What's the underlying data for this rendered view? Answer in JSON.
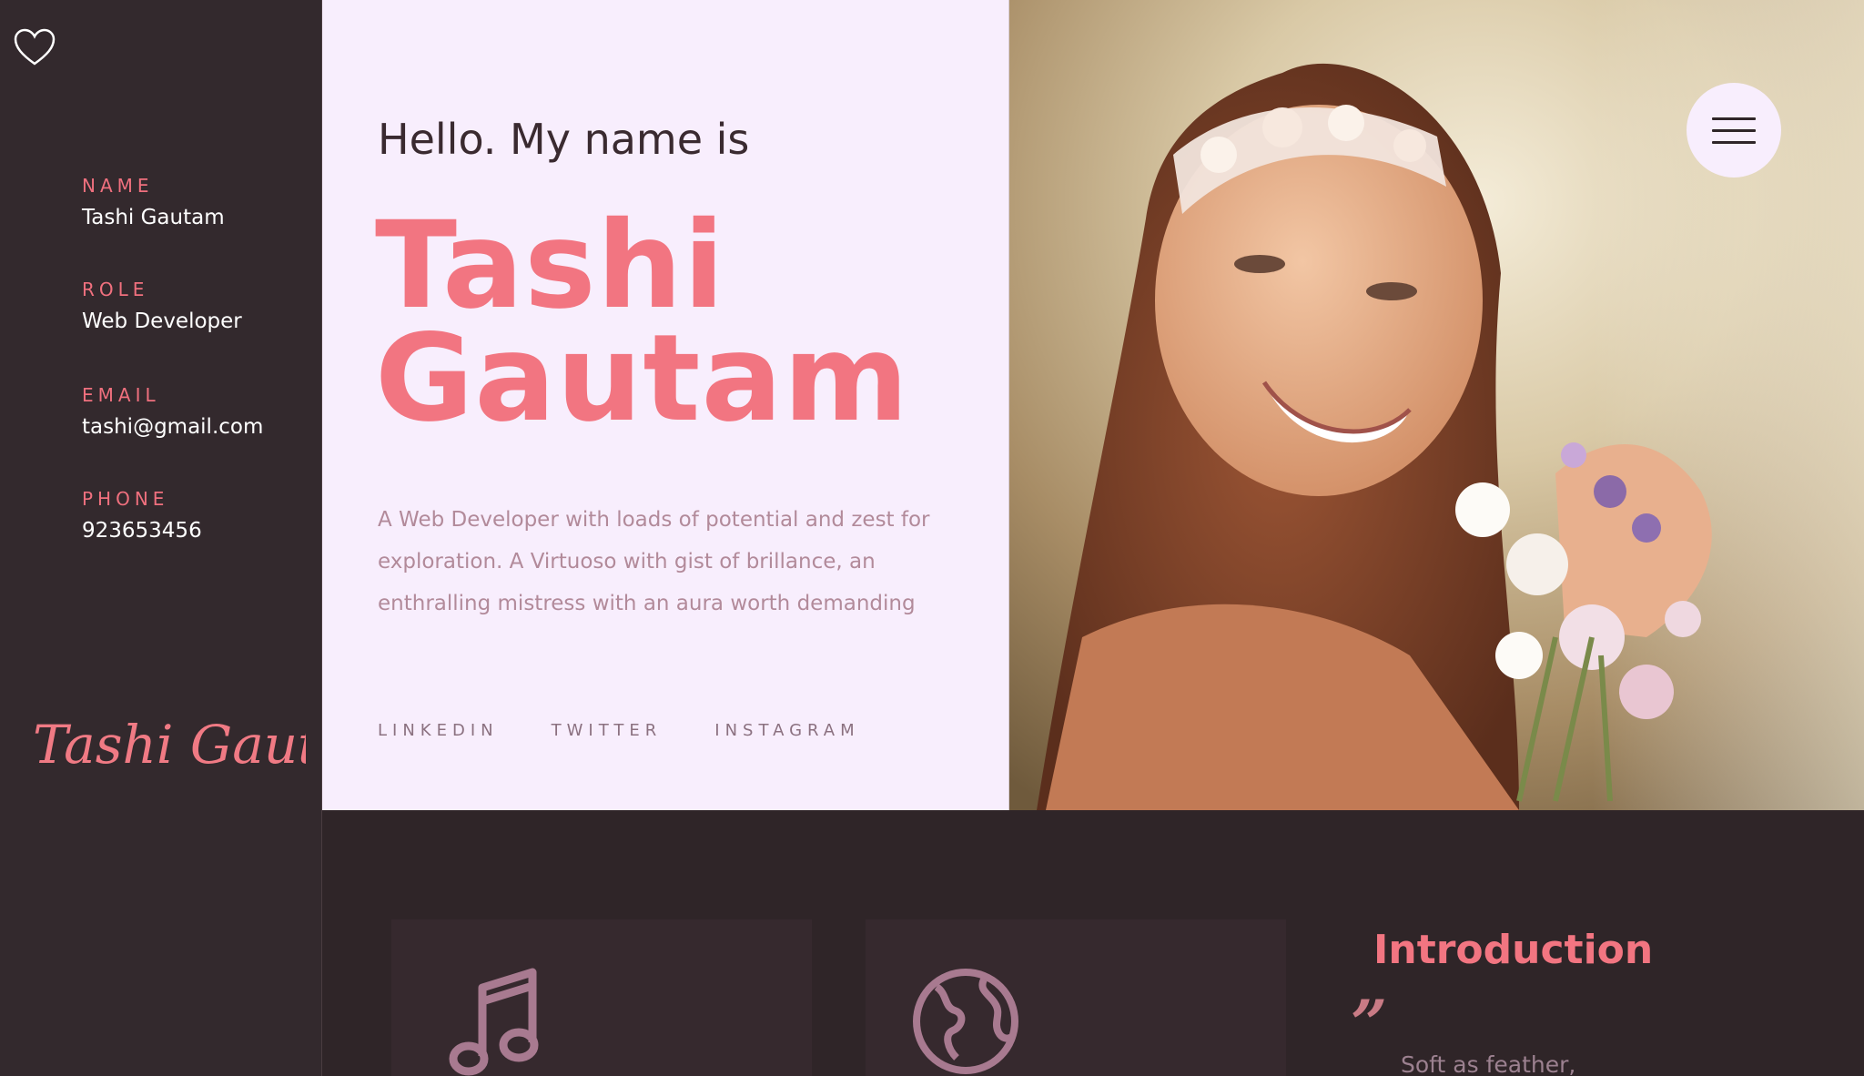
{
  "sidebar": {
    "heart_icon": "heart-outline-icon",
    "info": [
      {
        "label": "NAME",
        "value": "Tashi Gautam"
      },
      {
        "label": "ROLE",
        "value": "Web Developer"
      },
      {
        "label": "EMAIL",
        "value": "tashi@gmail.com"
      },
      {
        "label": "PHONE",
        "value": "923653456"
      }
    ],
    "signature": "Tashi Gautam"
  },
  "hero": {
    "greeting": "Hello. My name is",
    "first_name": "Tashi",
    "last_name": "Gautam",
    "bio": "A Web Developer with loads of potential and zest for exploration. A Virtuoso with gist of brillance, an enthralling mistress with an aura worth demanding",
    "socials": [
      "LINKEDIN",
      "TWITTER",
      "INSTAGRAM"
    ]
  },
  "menu_icon": "hamburger-menu-icon",
  "lower": {
    "cards": [
      {
        "icon": "music-note-icon"
      },
      {
        "icon": "globe-icon"
      }
    ],
    "intro_title": "Introduction",
    "quote_mark": "”",
    "quote_text": "Soft as feather,"
  },
  "colors": {
    "accent": "#f27581",
    "sidebar_bg": "#33292d",
    "hero_bg": "#f8eefd",
    "dark_bg": "#2f2528"
  }
}
